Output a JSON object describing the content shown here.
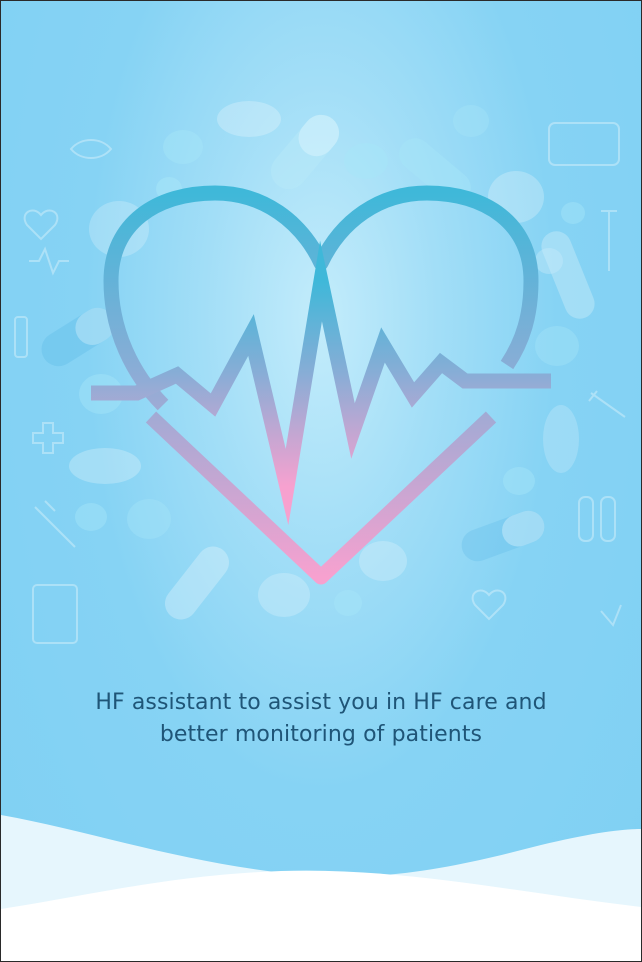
{
  "splash": {
    "tagline_line1": "HF assistant to assist you in HF care and",
    "tagline_line2": "better monitoring of patients"
  },
  "illustration": {
    "icon": "heart-rate-icon",
    "background_pattern": "medicine-pills-pattern",
    "heart_gradient": [
      "#3fb8d9",
      "#f7a1cf"
    ]
  },
  "colors": {
    "background": "#86d3f4",
    "tagline_text": "#1f5577",
    "wave_light": "#e6f6fd",
    "wave_white": "#ffffff"
  }
}
